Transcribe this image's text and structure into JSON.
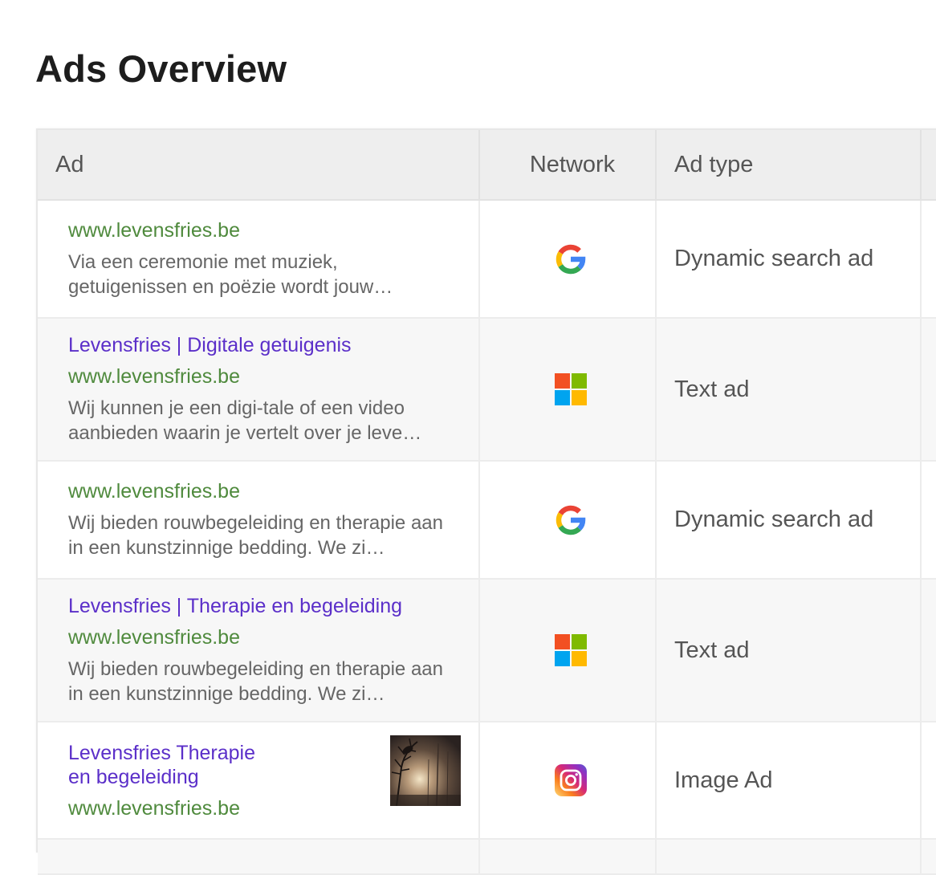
{
  "page": {
    "title": "Ads Overview"
  },
  "table": {
    "columns": {
      "ad": "Ad",
      "network": "Network",
      "ad_type": "Ad type"
    },
    "rows": [
      {
        "headline": "",
        "url": "www.levensfries.be",
        "description": "Via een ceremonie met muziek, getuigenissen en poëzie wordt jouw…",
        "network_icon": "google-icon",
        "ad_type": "Dynamic search ad"
      },
      {
        "headline": "Levensfries | Digitale getuigenis",
        "url": "www.levensfries.be",
        "description": "Wij kunnen je een digi-tale of een video aanbieden waarin je vertelt over je leve…",
        "network_icon": "microsoft-icon",
        "ad_type": "Text ad"
      },
      {
        "headline": "",
        "url": "www.levensfries.be",
        "description": "Wij bieden rouwbegeleiding en therapie aan in een kunstzinnige bedding. We zi…",
        "network_icon": "google-icon",
        "ad_type": "Dynamic search ad"
      },
      {
        "headline": "Levensfries | Therapie en begeleiding",
        "url": "www.levensfries.be",
        "description": "Wij bieden rouwbegeleiding en therapie aan in een kunstzinnige bedding. We zi…",
        "network_icon": "microsoft-icon",
        "ad_type": "Text ad"
      },
      {
        "headline": "Levensfries Therapie en begeleiding",
        "url": "www.levensfries.be",
        "description": "",
        "network_icon": "instagram-icon",
        "thumbnail": "reed-silhouette-sunset-thumbnail",
        "ad_type": "Image Ad"
      }
    ]
  },
  "colors": {
    "headline": "#5b2fc9",
    "url": "#4f8a3d",
    "description": "#666666",
    "header_bg": "#eeeeee",
    "even_row_bg": "#f7f7f7"
  }
}
